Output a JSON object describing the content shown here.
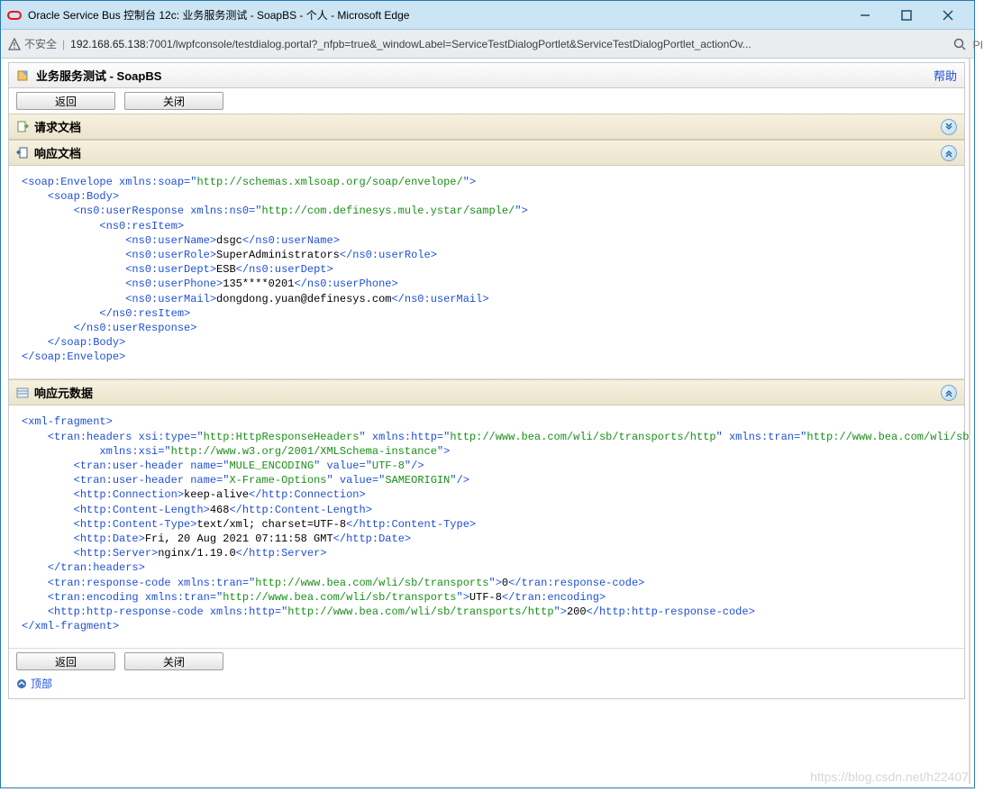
{
  "window": {
    "title": "Oracle Service Bus 控制台 12c: 业务服务测试 - SoapBS - 个人 - Microsoft Edge"
  },
  "address": {
    "insecure": "不安全",
    "host": "192.168.65.138",
    "rest": ":7001/lwpfconsole/testdialog.portal?_nfpb=true&_windowLabel=ServiceTestDialogPortlet&ServiceTestDialogPortlet_actionOv..."
  },
  "panel": {
    "title": "业务服务测试 - SoapBS",
    "help": "帮助",
    "back": "返回",
    "close": "关闭"
  },
  "sections": {
    "request_doc": "请求文档",
    "response_doc": "响应文档",
    "response_meta": "响应元数据"
  },
  "side_letter": "PI",
  "footer": {
    "top": "顶部"
  },
  "watermark": "https://blog.csdn.net/h22407",
  "xml1": {
    "l1a": "<",
    "l1b": "soap:Envelope",
    "l1c": " xmlns:soap",
    "l1d": "=\"",
    "l1e": "http://schemas.xmlsoap.org/soap/envelope/",
    "l1f": "\">",
    "l2a": "<",
    "l2b": "soap:Body",
    "l2c": ">",
    "l3a": "<",
    "l3b": "ns0:userResponse",
    "l3c": " xmlns:ns0",
    "l3d": "=\"",
    "l3e": "http://com.definesys.mule.ystar/sample/",
    "l3f": "\">",
    "l4a": "<",
    "l4b": "ns0:resItem",
    "l4c": ">",
    "l5a": "<",
    "l5b": "ns0:userName",
    "l5c": ">",
    "l5d": "dsgc",
    "l5e": "</",
    "l5f": "ns0:userName",
    "l5g": ">",
    "l6a": "<",
    "l6b": "ns0:userRole",
    "l6c": ">",
    "l6d": "SuperAdministrators",
    "l6e": "</",
    "l6f": "ns0:userRole",
    "l6g": ">",
    "l7a": "<",
    "l7b": "ns0:userDept",
    "l7c": ">",
    "l7d": "ESB",
    "l7e": "</",
    "l7f": "ns0:userDept",
    "l7g": ">",
    "l8a": "<",
    "l8b": "ns0:userPhone",
    "l8c": ">",
    "l8d": "135****0201",
    "l8e": "</",
    "l8f": "ns0:userPhone",
    "l8g": ">",
    "l9a": "<",
    "l9b": "ns0:userMail",
    "l9c": ">",
    "l9d": "dongdong.yuan@definesys.com",
    "l9e": "</",
    "l9f": "ns0:userMail",
    "l9g": ">",
    "l10a": "</",
    "l10b": "ns0:resItem",
    "l10c": ">",
    "l11a": "</",
    "l11b": "ns0:userResponse",
    "l11c": ">",
    "l12a": "</",
    "l12b": "soap:Body",
    "l12c": ">",
    "l13a": "</",
    "l13b": "soap:Envelope",
    "l13c": ">"
  },
  "xml2": {
    "l1a": "<",
    "l1b": "xml-fragment",
    "l1c": ">",
    "l2a": "<",
    "l2b": "tran:headers",
    "l2c": " xsi:type",
    "l2d": "=\"",
    "l2e": "http:HttpResponseHeaders",
    "l2f": "\" xmlns:http",
    "l2g": "=\"",
    "l2h": "http://www.bea.com/wli/sb/transports/http",
    "l2i": "\" xmlns:tran",
    "l2j": "=\"",
    "l2k": "http://www.bea.com/wli/sb/transports",
    "l2l": "\"",
    "l2ma": "xmlns:xsi",
    "l2mb": "=\"",
    "l2mc": "http://www.w3.org/2001/XMLSchema-instance",
    "l2md": "\">",
    "l3a": "<",
    "l3b": "tran:user-header",
    "l3c": " name",
    "l3d": "=\"",
    "l3e": "MULE_ENCODING",
    "l3f": "\" value",
    "l3g": "=\"",
    "l3h": "UTF-8",
    "l3i": "\"/>",
    "l4a": "<",
    "l4b": "tran:user-header",
    "l4c": " name",
    "l4d": "=\"",
    "l4e": "X-Frame-Options",
    "l4f": "\" value",
    "l4g": "=\"",
    "l4h": "SAMEORIGIN",
    "l4i": "\"/>",
    "l5a": "<",
    "l5b": "http:Connection",
    "l5c": ">",
    "l5d": "keep-alive",
    "l5e": "</",
    "l5f": "http:Connection",
    "l5g": ">",
    "l6a": "<",
    "l6b": "http:Content-Length",
    "l6c": ">",
    "l6d": "468",
    "l6e": "</",
    "l6f": "http:Content-Length",
    "l6g": ">",
    "l7a": "<",
    "l7b": "http:Content-Type",
    "l7c": ">",
    "l7d": "text/xml; charset=UTF-8",
    "l7e": "</",
    "l7f": "http:Content-Type",
    "l7g": ">",
    "l8a": "<",
    "l8b": "http:Date",
    "l8c": ">",
    "l8d": "Fri, 20 Aug 2021 07:11:58 GMT",
    "l8e": "</",
    "l8f": "http:Date",
    "l8g": ">",
    "l9a": "<",
    "l9b": "http:Server",
    "l9c": ">",
    "l9d": "nginx/1.19.0",
    "l9e": "</",
    "l9f": "http:Server",
    "l9g": ">",
    "l10a": "</",
    "l10b": "tran:headers",
    "l10c": ">",
    "l11a": "<",
    "l11b": "tran:response-code",
    "l11c": " xmlns:tran",
    "l11d": "=\"",
    "l11e": "http://www.bea.com/wli/sb/transports",
    "l11f": "\">",
    "l11g": "0",
    "l11h": "</",
    "l11i": "tran:response-code",
    "l11j": ">",
    "l12a": "<",
    "l12b": "tran:encoding",
    "l12c": " xmlns:tran",
    "l12d": "=\"",
    "l12e": "http://www.bea.com/wli/sb/transports",
    "l12f": "\">",
    "l12g": "UTF-8",
    "l12h": "</",
    "l12i": "tran:encoding",
    "l12j": ">",
    "l13a": "<",
    "l13b": "http:http-response-code",
    "l13c": " xmlns:http",
    "l13d": "=\"",
    "l13e": "http://www.bea.com/wli/sb/transports/http",
    "l13f": "\">",
    "l13g": "200",
    "l13h": "</",
    "l13i": "http:http-response-code",
    "l13j": ">",
    "l14a": "</",
    "l14b": "xml-fragment",
    "l14c": ">"
  }
}
